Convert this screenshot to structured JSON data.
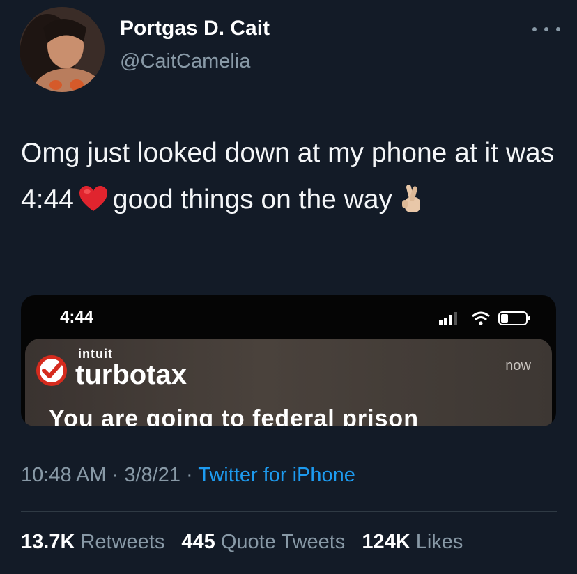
{
  "user": {
    "display_name": "Portgas D. Cait",
    "handle": "@CaitCamelia"
  },
  "tweet": {
    "text_part1": "Omg just looked down at my phone at it was 4:44",
    "text_part2": "good things on the way",
    "emoji_1": "red-heart",
    "emoji_2": "crossed-fingers"
  },
  "media": {
    "status_time": "4:44",
    "notification": {
      "brand_top": "intuit",
      "brand": "turbotax",
      "time": "now",
      "body": "You are going to federal prison"
    }
  },
  "meta": {
    "time": "10:48 AM",
    "separator": "·",
    "date": "3/8/21",
    "source": "Twitter for iPhone"
  },
  "stats": {
    "retweets_count": "13.7K",
    "retweets_label": "Retweets",
    "quotes_count": "445",
    "quotes_label": "Quote Tweets",
    "likes_count": "124K",
    "likes_label": "Likes"
  },
  "colors": {
    "background": "#131b27",
    "secondary_text": "#8899a6",
    "link": "#1d9bf0",
    "heart": "#e0242e",
    "turbotax_red": "#d52b1e"
  }
}
